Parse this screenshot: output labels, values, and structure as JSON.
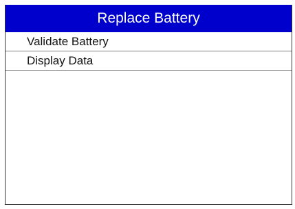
{
  "screen": {
    "title": "Replace Battery",
    "title_bg": "#0000cc",
    "title_color": "#ffffff"
  },
  "menu": {
    "items": [
      {
        "label": "Validate Battery"
      },
      {
        "label": "Display Data"
      }
    ]
  }
}
